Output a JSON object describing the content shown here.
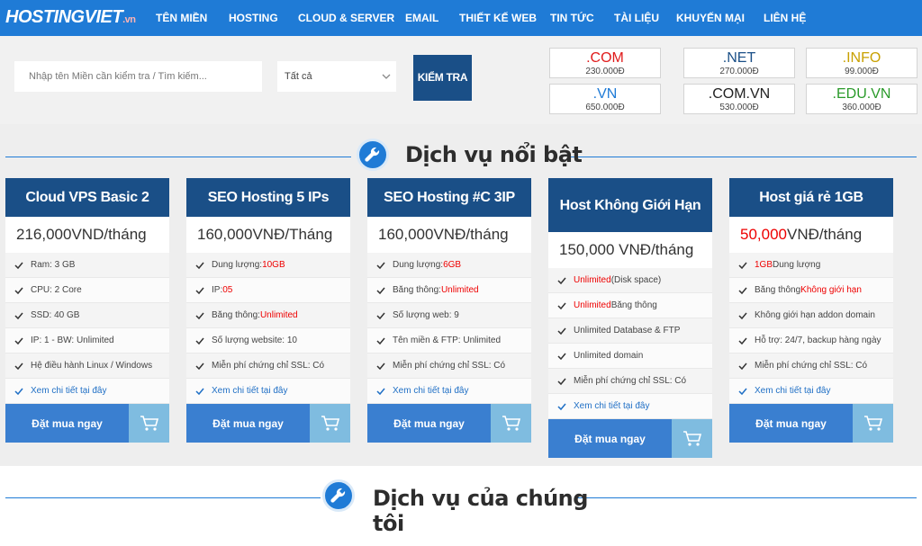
{
  "logo": {
    "main": "HOSTINGVIET",
    "suffix": ".vn"
  },
  "nav": {
    "items": [
      "TÊN MIỀN",
      "HOSTING",
      "CLOUD & SERVER",
      "EMAIL",
      "THIẾT KẾ WEB",
      "TIN TỨC",
      "TÀI LIỆU",
      "KHUYẾN MẠI",
      "LIÊN HỆ"
    ]
  },
  "search": {
    "placeholder": "Nhập tên Miền cần kiểm tra / Tìm kiếm...",
    "select_value": "Tất cả",
    "button_label": "KIỂM TRA"
  },
  "tlds": [
    {
      "ext": ".COM",
      "price": "230.000Đ",
      "color": "#e01b1b"
    },
    {
      "ext": ".NET",
      "price": "270.000Đ",
      "color": "#1a4f87"
    },
    {
      "ext": ".INFO",
      "price": "99.000Đ",
      "color": "#c8a000"
    },
    {
      "ext": ".VN",
      "price": "650.000Đ",
      "color": "#1f7bd6"
    },
    {
      "ext": ".COM.VN",
      "price": "530.000Đ",
      "color": "#222222"
    },
    {
      "ext": ".EDU.VN",
      "price": "360.000Đ",
      "color": "#2a9a2a"
    }
  ],
  "featured": {
    "title": "Dịch vụ nổi bật"
  },
  "cards": [
    {
      "title": "Cloud VPS Basic 2",
      "price": "216,000VND/tháng",
      "features": [
        {
          "t": "Ram: 3 GB"
        },
        {
          "t": "CPU: 2 Core"
        },
        {
          "t": "SSD: 40 GB"
        },
        {
          "t": "IP: 1  -  BW: Unlimited"
        },
        {
          "t": "Hệ điều hành Linux / Windows"
        },
        {
          "t": "Xem chi tiết tại đây"
        }
      ],
      "buy": "Đặt mua ngay"
    },
    {
      "title": "SEO Hosting 5 IPs",
      "price": "160,000VNĐ/Tháng",
      "features": [
        {
          "t": "Dung lượng: ",
          "r": "10GB"
        },
        {
          "t": "IP: ",
          "r": "05"
        },
        {
          "t": "Băng thông: ",
          "r": "Unlimited"
        },
        {
          "t": "Số lượng website: 10"
        },
        {
          "t": "Miễn phí chứng chỉ SSL: Có"
        },
        {
          "t": "Xem chi tiết tại đây"
        }
      ],
      "buy": "Đặt mua ngay"
    },
    {
      "title": "SEO Hosting #C 3IP",
      "price": "160,000VNĐ/tháng",
      "features": [
        {
          "t": "Dung lượng: ",
          "r": "6GB"
        },
        {
          "t": "Băng thông: ",
          "r": "Unlimited"
        },
        {
          "t": "Số lượng web: 9"
        },
        {
          "t": "Tên miền & FTP: Unlimited"
        },
        {
          "t": "Miễn phí chứng chỉ SSL: Có"
        },
        {
          "t": "Xem chi tiết tại đây"
        }
      ],
      "buy": "Đặt mua ngay"
    },
    {
      "title": "Host Không Giới Hạn",
      "price": "150,000 VNĐ/tháng",
      "features": [
        {
          "r0": "Unlimited",
          "t": " (Disk space)"
        },
        {
          "r0": "Unlimited",
          "t": " Băng thông"
        },
        {
          "t": "Unlimited Database &  FTP"
        },
        {
          "t": "Unlimited domain"
        },
        {
          "t": "Miễn phí chứng chỉ SSL: Có"
        },
        {
          "t": "Xem chi tiết tại đây"
        }
      ],
      "buy": "Đặt mua ngay"
    },
    {
      "title": "Host giá rẻ 1GB",
      "price_red": "50,000",
      "price": " VNĐ/tháng",
      "features": [
        {
          "r0": "1GB",
          "t": " Dung lượng"
        },
        {
          "t": "Băng thông ",
          "r": "Không giới hạn"
        },
        {
          "t": "Không giới hạn addon domain"
        },
        {
          "t": "Hỗ trợ: 24/7, backup hàng ngày"
        },
        {
          "t": "Miễn phí chứng chỉ SSL: Có"
        },
        {
          "t": "Xem chi tiết tại đây"
        }
      ],
      "buy": "Đặt mua ngay"
    }
  ],
  "our_services": {
    "title_line1": "Dịch vụ của chúng",
    "title_line2": "tôi"
  }
}
